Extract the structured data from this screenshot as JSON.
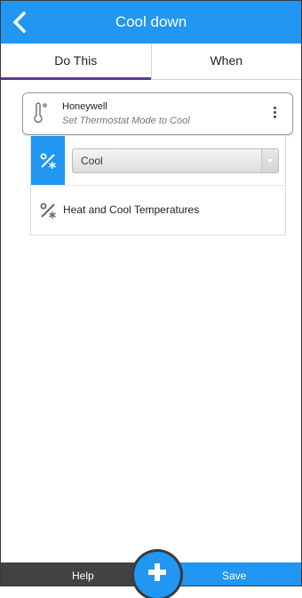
{
  "header": {
    "title": "Cool down",
    "back_icon": "chevron-left-icon"
  },
  "tabs": [
    {
      "label": "Do This",
      "active": true
    },
    {
      "label": "When",
      "active": false
    }
  ],
  "device": {
    "name": "Honeywell",
    "action": "Set Thermostat Mode to Cool",
    "icon": "thermometer-icon",
    "menu_icon": "more-vertical-icon"
  },
  "options": [
    {
      "type": "select",
      "value": "Cool",
      "icon": "percent-snowflake-icon",
      "selected": true
    },
    {
      "type": "label",
      "label": "Heat and Cool Temperatures",
      "icon": "percent-snowflake-icon",
      "selected": false
    }
  ],
  "footer": {
    "help_label": "Help",
    "save_label": "Save",
    "add_icon": "plus-icon"
  },
  "colors": {
    "primary": "#2196f3",
    "tab_indicator": "#5e3a8f",
    "footer_dark": "#424242"
  }
}
